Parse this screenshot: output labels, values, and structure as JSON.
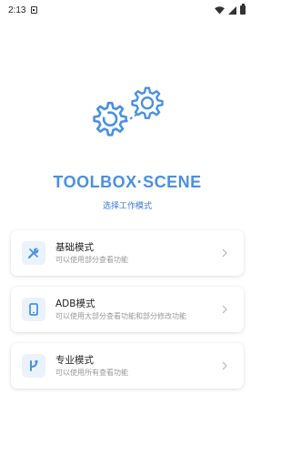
{
  "status_bar": {
    "time": "2:13"
  },
  "app": {
    "title": "TOOLBOX·SCENE",
    "subtitle": "选择工作模式"
  },
  "modes": [
    {
      "title": "基础模式",
      "desc": "可以使用部分查看功能",
      "icon": "wrench-icon"
    },
    {
      "title": "ADB模式",
      "desc": "可以使用大部分查看功能和部分修改功能",
      "icon": "phone-icon"
    },
    {
      "title": "专业模式",
      "desc": "可以使用所有查看功能",
      "icon": "branch-icon"
    }
  ],
  "colors": {
    "accent": "#4a90e2",
    "icon_bg": "#eaf2fc",
    "chevron": "#c0c0c0"
  }
}
